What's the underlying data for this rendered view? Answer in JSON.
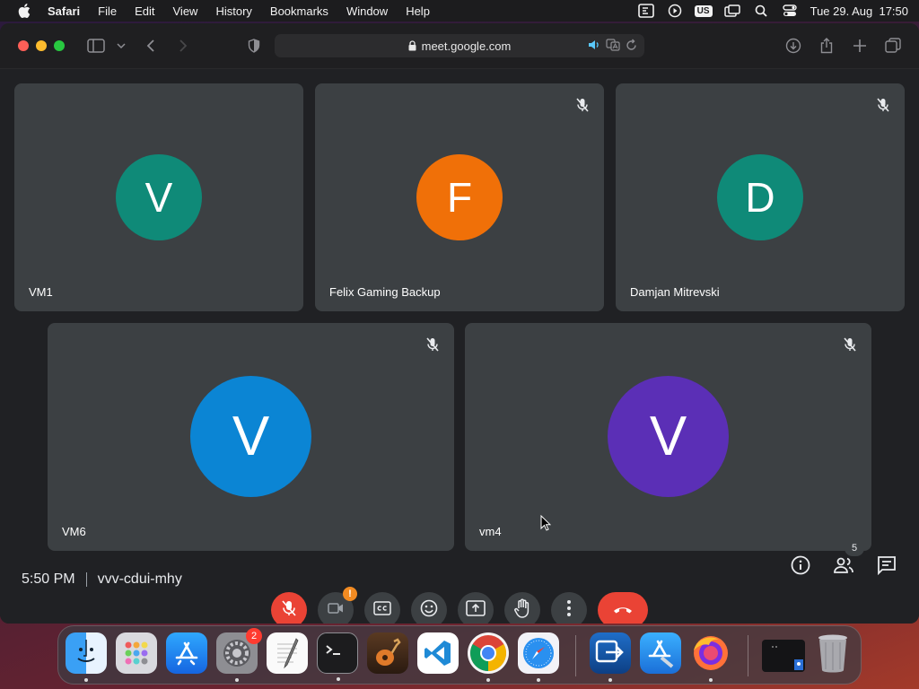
{
  "menubar": {
    "app": "Safari",
    "items": [
      "File",
      "Edit",
      "View",
      "History",
      "Bookmarks",
      "Window",
      "Help"
    ],
    "input_source": "US",
    "datetime": "Tue 29. Aug  17:50"
  },
  "browser": {
    "url": "meet.google.com"
  },
  "participants": [
    {
      "name": "VM1",
      "initial": "V",
      "color": "#0f8a78",
      "muted": false
    },
    {
      "name": "Felix Gaming Backup",
      "initial": "F",
      "color": "#f07008",
      "muted": true
    },
    {
      "name": "Damjan Mitrevski",
      "initial": "D",
      "color": "#0f8a78",
      "muted": true
    },
    {
      "name": "VM6",
      "initial": "V",
      "color": "#0b85d4",
      "muted": true
    },
    {
      "name": "vm4",
      "initial": "V",
      "color": "#5b2fb6",
      "muted": true
    }
  ],
  "meeting": {
    "time": "5:50 PM",
    "code": "vvv-cdui-mhy",
    "people_count": "5",
    "camera_warning": "!"
  },
  "dock": {
    "settings_badge": "2",
    "apps": [
      "finder-icon",
      "launchpad-icon",
      "app-store-icon",
      "system-settings-icon",
      "textedit-icon",
      "terminal-icon",
      "garageband-icon",
      "vscode-icon",
      "chrome-icon",
      "safari-icon",
      "migration-icon",
      "xcode-icon",
      "firefox-icon",
      "screen-sharing-icon",
      "trash-icon"
    ]
  }
}
